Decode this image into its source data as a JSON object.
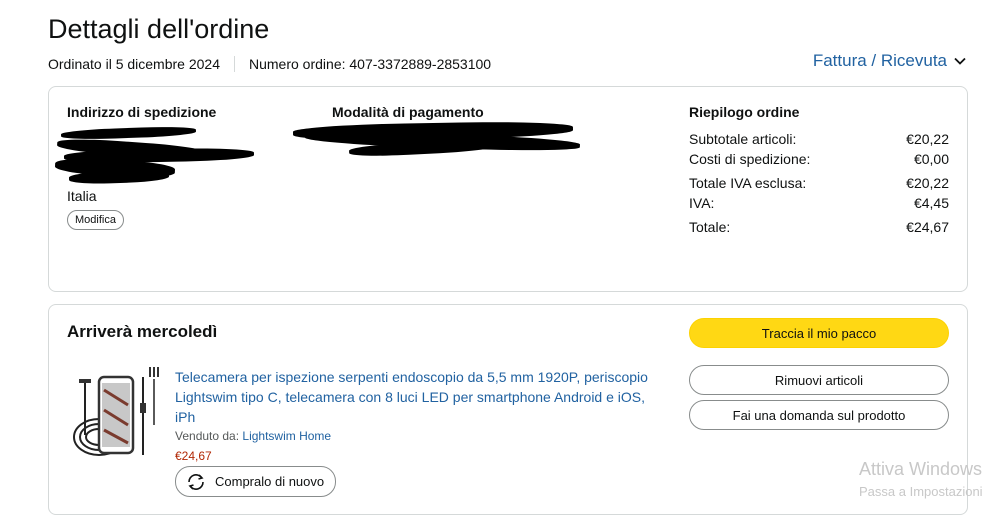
{
  "page": {
    "title": "Dettagli dell'ordine",
    "order_date": "Ordinato il 5 dicembre 2024",
    "order_number": "Numero ordine: 407-3372889-2853100",
    "invoice_link": "Fattura / Ricevuta"
  },
  "shipping": {
    "heading": "Indirizzo di spedizione",
    "country": "Italia",
    "edit_label": "Modifica"
  },
  "payment": {
    "heading": "Modalità di pagamento"
  },
  "summary": {
    "heading": "Riepilogo ordine",
    "rows": [
      {
        "label": "Subtotale articoli:",
        "value": "€20,22"
      },
      {
        "label": "Costi di spedizione:",
        "value": "€0,00"
      },
      {
        "label": "Totale IVA esclusa:",
        "value": "€20,22"
      },
      {
        "label": "IVA:",
        "value": "€4,45"
      },
      {
        "label": "Totale:",
        "value": "€24,67"
      }
    ]
  },
  "delivery": {
    "heading": "Arriverà mercoledì",
    "product_title": "Telecamera per ispezione serpenti endoscopio da 5,5 mm 1920P, periscopio Lightswim tipo C, telecamera con 8 luci LED per smartphone Android e iOS, iPh",
    "sold_by_label": "Venduto da:",
    "seller": "Lightswim Home",
    "price": "€24,67",
    "buy_again_label": "Compralo di nuovo",
    "buttons": {
      "track": "Traccia il mio pacco",
      "remove": "Rimuovi articoli",
      "question": "Fai una domanda sul prodotto"
    }
  },
  "watermark": {
    "line1": "Attiva Windows",
    "line2": "Passa a Impostazioni"
  },
  "colors": {
    "link": "#2162a1",
    "accent_button": "#ffd814",
    "price": "#b12704",
    "border": "#d5d9d9"
  },
  "icons": {
    "invoice_chevron": "chevron-down-icon",
    "buy_again": "refresh-icon"
  }
}
